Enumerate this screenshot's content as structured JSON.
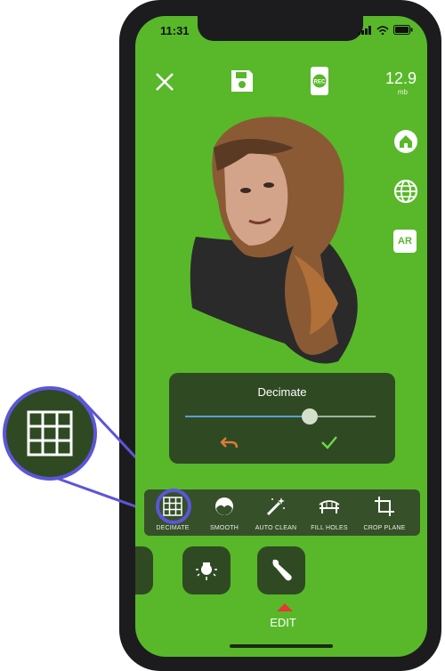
{
  "status_bar": {
    "time": "11:31"
  },
  "top_bar": {
    "file_size_value": "12.9",
    "file_size_unit": "mb"
  },
  "side_buttons": {
    "ar_label": "AR"
  },
  "decimate_panel": {
    "title": "Decimate",
    "slider_level": 0.6
  },
  "toolbar": {
    "items": [
      {
        "label": "DECIMATE",
        "icon": "grid-icon"
      },
      {
        "label": "SMOOTH",
        "icon": "smooth-icon"
      },
      {
        "label": "AUTO CLEAN",
        "icon": "magic-wand-icon"
      },
      {
        "label": "FILL HOLES",
        "icon": "bridge-icon"
      },
      {
        "label": "CROP PLANE",
        "icon": "crop-icon"
      }
    ]
  },
  "bottom_bar": {
    "edit_label": "EDIT"
  },
  "colors": {
    "background": "#58b82a",
    "panel": "#2f4a22",
    "highlight": "#5b56d8",
    "undo": "#e07a3a",
    "confirm": "#6fd84a"
  }
}
